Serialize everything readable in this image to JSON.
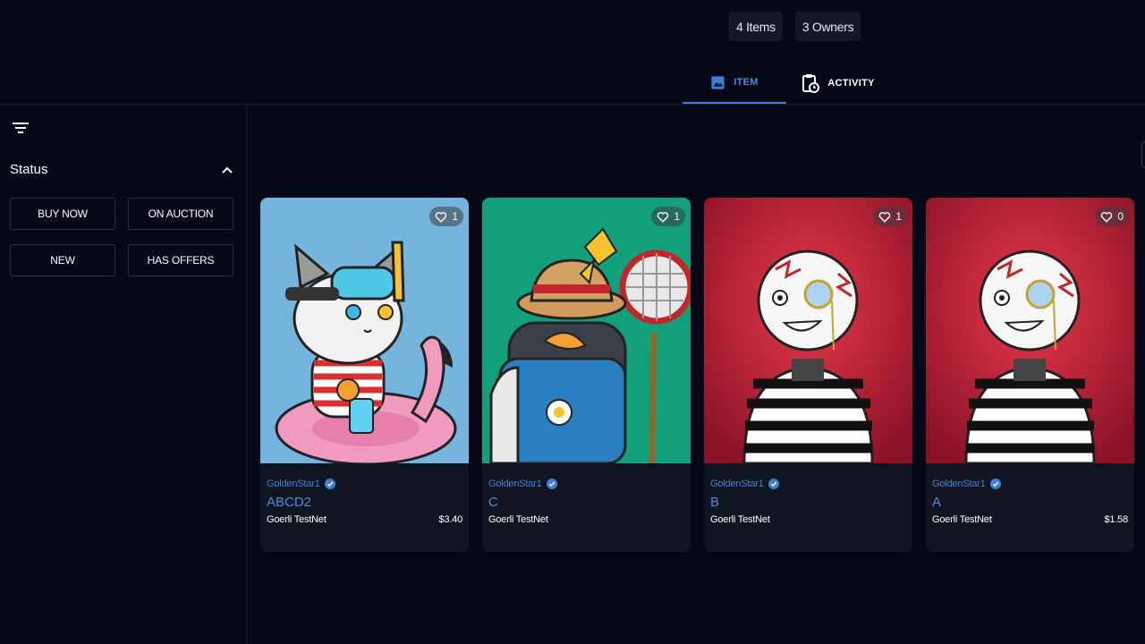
{
  "stats": {
    "items": "4 Items",
    "owners": "3 Owners"
  },
  "tabs": [
    {
      "label": "ITEM",
      "icon": "image-icon",
      "active": true
    },
    {
      "label": "ACTIVITY",
      "icon": "clipboard-clock-icon",
      "active": false
    }
  ],
  "sidebar": {
    "status_title": "Status",
    "filters": [
      "BUY NOW",
      "ON AUCTION",
      "NEW",
      "HAS OFFERS"
    ]
  },
  "cards": [
    {
      "creator": "GoldenStar1",
      "name": "ABCD2",
      "network": "Goerli TestNet",
      "price": "$3.40",
      "likes": "1",
      "art": "cat-flamingo"
    },
    {
      "creator": "GoldenStar1",
      "name": "C",
      "network": "Goerli TestNet",
      "price": "",
      "likes": "1",
      "art": "penguin-net"
    },
    {
      "creator": "GoldenStar1",
      "name": "B",
      "network": "Goerli TestNet",
      "price": "",
      "likes": "1",
      "art": "mime-monocle"
    },
    {
      "creator": "GoldenStar1",
      "name": "A",
      "network": "Goerli TestNet",
      "price": "$1.58",
      "likes": "0",
      "art": "mime-monocle"
    }
  ],
  "colors": {
    "background": "#050816",
    "card": "#111522",
    "accent": "#3d7fd6"
  }
}
